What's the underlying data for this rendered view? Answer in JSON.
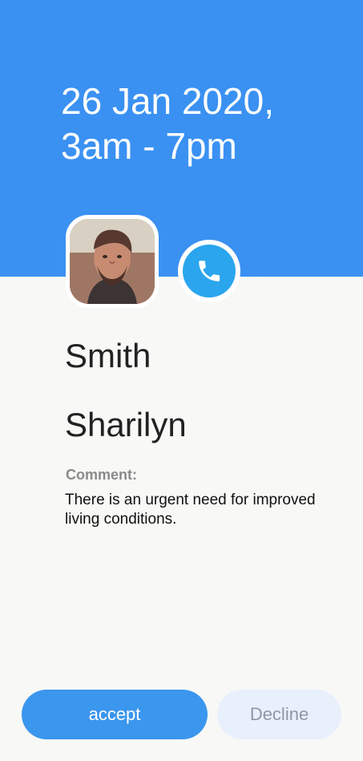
{
  "header": {
    "date_line1": "26 Jan 2020,",
    "date_line2": "3am - 7pm"
  },
  "profile": {
    "avatar_icon": "person-photo",
    "call_icon": "phone-icon",
    "last_name": "Smith",
    "first_name": "Sharilyn"
  },
  "comment": {
    "label": "Comment:",
    "text": "There is an urgent need for improved living conditions."
  },
  "actions": {
    "accept_label": "accept",
    "decline_label": "Decline"
  },
  "colors": {
    "primary_blue": "#3a91f2",
    "call_blue": "#2aa5ee",
    "accept_blue": "#3b96ee",
    "decline_bg": "#e8f0fb",
    "decline_text": "#8f97a6",
    "background": "#f8f8f6"
  }
}
